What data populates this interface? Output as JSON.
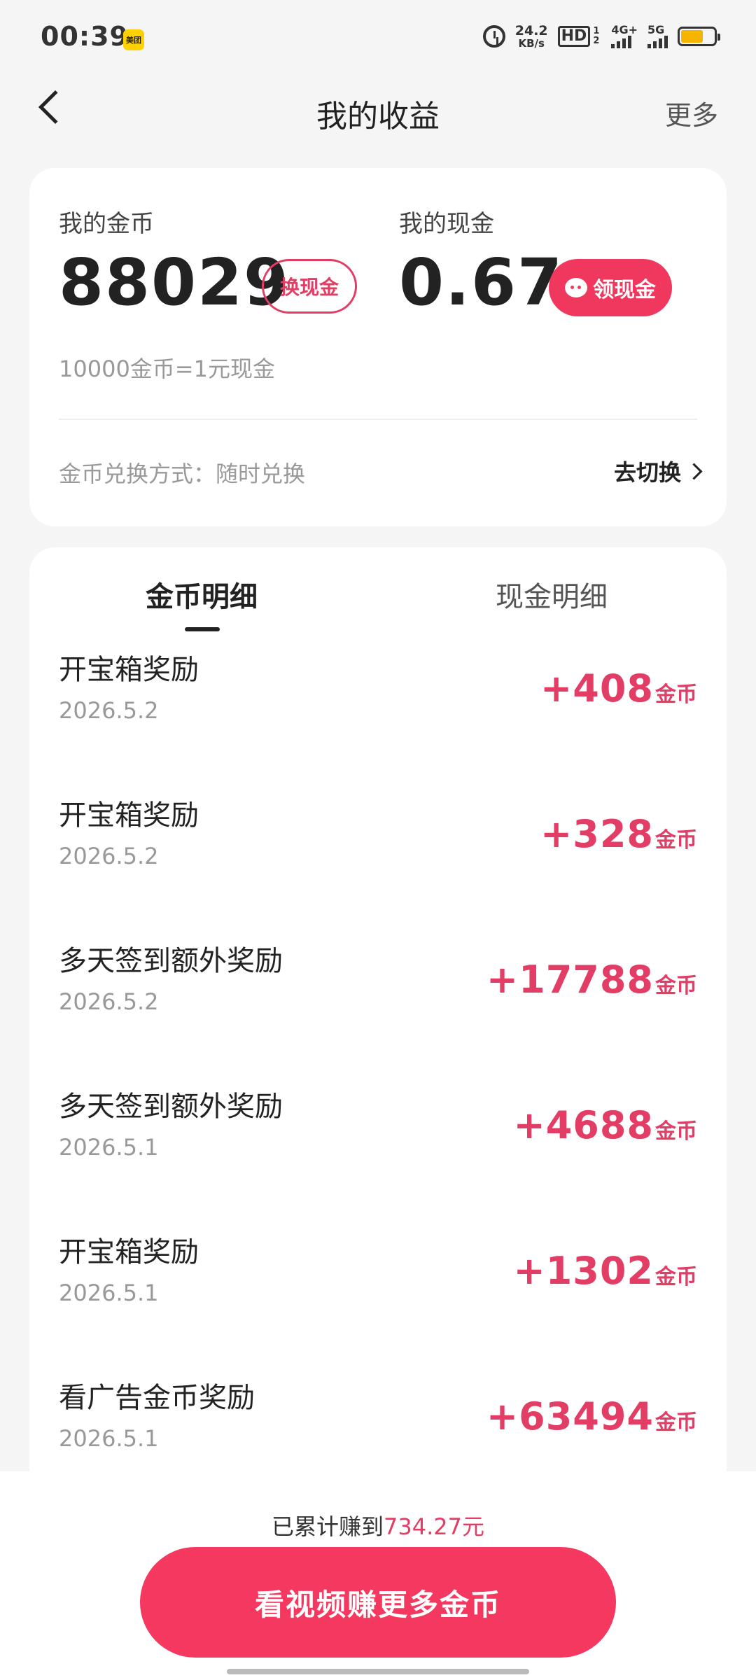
{
  "status_bar": {
    "time": "00:39",
    "app_badge": "美团",
    "net_speed_value": "24.2",
    "net_speed_unit": "KB/s",
    "hd_label": "HD",
    "hd_sub": "1 2",
    "sig1_label": "4G+",
    "sig2_label": "5G",
    "battery_color": "#f5b400"
  },
  "nav": {
    "title": "我的收益",
    "more_label": "更多"
  },
  "summary": {
    "coin_label": "我的金币",
    "coin_value": "88029",
    "exchange_btn": "换现金",
    "cash_label": "我的现金",
    "cash_value": "0.67",
    "withdraw_btn": "领现金",
    "rate_text": "10000金币=1元现金",
    "exchange_mode_text": "金币兑换方式：随时兑换",
    "switch_label": "去切换"
  },
  "tabs": [
    {
      "label": "金币明细",
      "active": true
    },
    {
      "label": "现金明细",
      "active": false
    }
  ],
  "records": [
    {
      "title": "开宝箱奖励",
      "date": "2026.5.2",
      "amount": "+408",
      "unit": "金币"
    },
    {
      "title": "开宝箱奖励",
      "date": "2026.5.2",
      "amount": "+328",
      "unit": "金币"
    },
    {
      "title": "多天签到额外奖励",
      "date": "2026.5.2",
      "amount": "+17788",
      "unit": "金币"
    },
    {
      "title": "多天签到额外奖励",
      "date": "2026.5.1",
      "amount": "+4688",
      "unit": "金币"
    },
    {
      "title": "开宝箱奖励",
      "date": "2026.5.1",
      "amount": "+1302",
      "unit": "金币"
    },
    {
      "title": "看广告金币奖励",
      "date": "2026.5.1",
      "amount": "+63494",
      "unit": "金币"
    }
  ],
  "bottom": {
    "total_prefix": "已累计赚到",
    "total_amount": "734.27元",
    "cta_label": "看视频赚更多金币"
  },
  "colors": {
    "accent": "#e23d64",
    "cta": "#f5385f"
  }
}
